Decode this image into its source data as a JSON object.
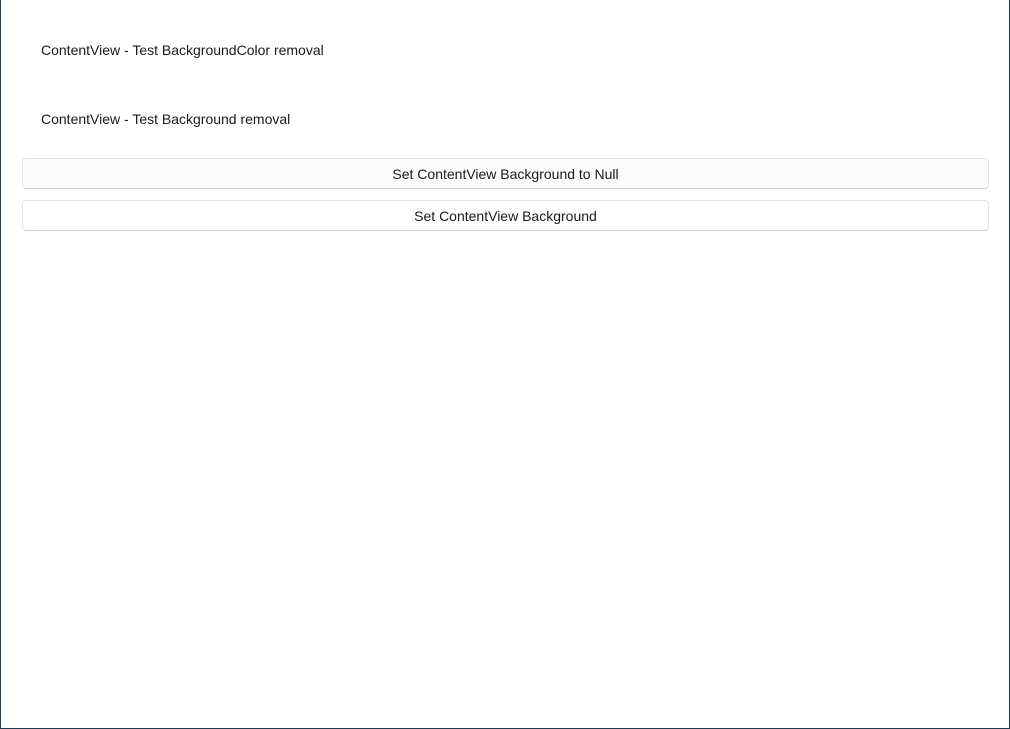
{
  "content_views": [
    {
      "label": "ContentView - Test BackgroundColor removal"
    },
    {
      "label": "ContentView - Test Background removal"
    }
  ],
  "buttons": {
    "set_null_label": "Set ContentView Background to Null",
    "set_background_label": "Set ContentView Background"
  },
  "colors": {
    "window_border": "#1f3b4d",
    "button_background": "#fbfbfb",
    "button_border": "#e3e3e3"
  }
}
